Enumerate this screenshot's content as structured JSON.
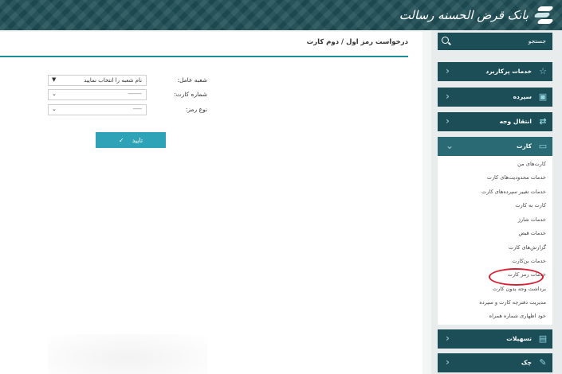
{
  "header": {
    "brand_text": "بانک قرض الحسنه رسالت"
  },
  "page": {
    "title": "درخواست رمز اول / دوم کارت"
  },
  "form": {
    "branch_label": "شعبه عامل:",
    "branch_value": "نام شعبه را انتخاب نمایید",
    "card_number_label": "شماره کارت:",
    "card_number_value": "-----------",
    "password_type_label": "نوع رمز:",
    "password_type_value": "-------",
    "confirm_label": "تایید"
  },
  "sidebar": {
    "search_placeholder": "جستجو",
    "menus": [
      {
        "label": "خدمات پرکاربرد",
        "icon": "star-icon"
      },
      {
        "label": "سپرده",
        "icon": "deposit-icon"
      },
      {
        "label": "انتقال وجه",
        "icon": "transfer-icon"
      },
      {
        "label": "کارت",
        "icon": "card-icon"
      },
      {
        "label": "تسهیلات",
        "icon": "loan-icon"
      },
      {
        "label": "چک",
        "icon": "cheque-icon"
      }
    ],
    "card_items": [
      "کارت‌های من",
      "خدمات محدودیت‌های کارت",
      "خدمات تغییر سپرده‌های کارت",
      "کارت به کارت",
      "خدمات شارژ",
      "خدمات قبض",
      "گزارش‌های کارت",
      "خدمات بن‌کارت",
      "خدمات رمز کارت",
      "برداشت وجه بدون کارت",
      "مدیریت دفترچه کارت و سپرده",
      "خود اظهاری شماره همراه"
    ]
  },
  "colors": {
    "header_bg": "#1f4f56",
    "menu_bg": "#1c4e58",
    "accent_line": "#1c8e9a",
    "button_bg": "#2ea3b8",
    "highlight_ring": "#d71f33"
  }
}
